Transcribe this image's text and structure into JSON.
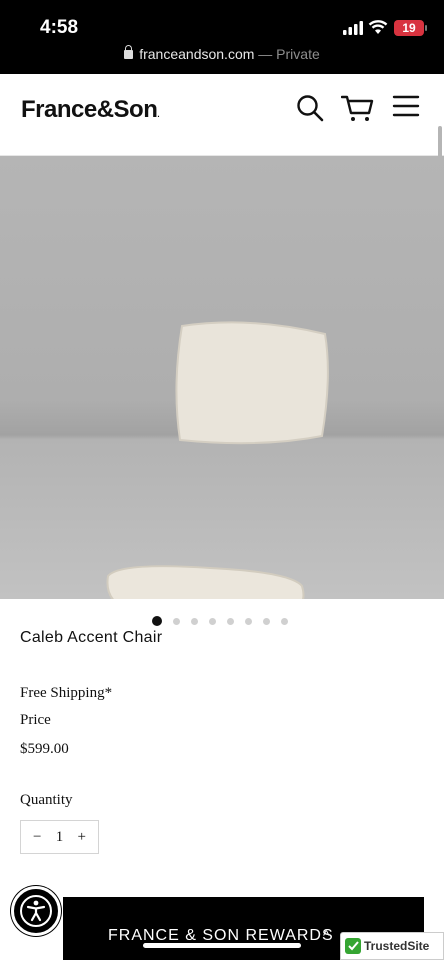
{
  "status_bar": {
    "time": "4:58",
    "battery": "19"
  },
  "browser": {
    "url": "franceandson.com",
    "privacy": "— Private"
  },
  "header": {
    "logo": "France&Son",
    "logo_mark": "."
  },
  "product": {
    "title": "Caleb Accent Chair",
    "shipping": "Free Shipping*",
    "price_label": "Price",
    "price": "$599.00",
    "quantity_label": "Quantity",
    "quantity": "1",
    "minus": "−",
    "plus": "+"
  },
  "carousel": {
    "total_images": 8,
    "active_index": 0
  },
  "footer": {
    "rewards_label": "FRANCE & SON REWARDS",
    "rewards_chevron": "^",
    "trusted_site": "TrustedSite"
  },
  "icons": [
    "lock-icon",
    "search-icon",
    "cart-icon",
    "menu-icon",
    "heart-icon",
    "zoom-icon",
    "accessibility-icon",
    "check-icon"
  ],
  "colors": {
    "status_bar": "#000000",
    "battery_badge": "#d8333f",
    "trusted_check": "#35a532"
  }
}
